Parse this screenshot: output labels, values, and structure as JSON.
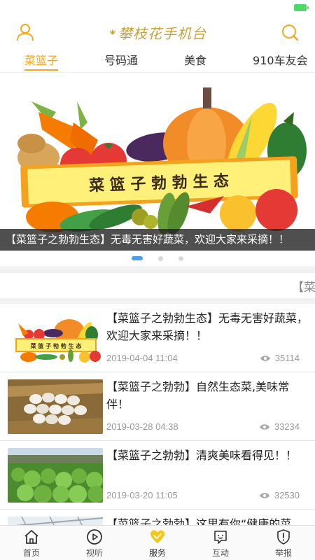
{
  "colors": {
    "accent": "#f5a623",
    "logo_gold": "#c8a13a",
    "indicator_blue": "#4a9eea",
    "battery_green": "#4cd964"
  },
  "header": {
    "logo_text": "攀枝花手机台",
    "left_icon": "user-icon",
    "right_icon": "search-icon"
  },
  "tabs": [
    {
      "label": "菜篮子",
      "active": true
    },
    {
      "label": "号码通",
      "active": false
    },
    {
      "label": "美食",
      "active": false
    },
    {
      "label": "910车友会",
      "active": false
    }
  ],
  "banner": {
    "sign_text": "菜 篮 子 勃 勃 生 态",
    "caption": "【菜篮子之勃勃生态】无毒无害好蔬菜，欢迎大家来采摘！！",
    "page_count": 3,
    "active_page": 0
  },
  "marquee": {
    "text": "【菜"
  },
  "news": [
    {
      "title": "【菜篮子之勃勃生态】无毒无害好蔬菜，欢迎大家来采摘！！",
      "date": "2019-04-04 11:04",
      "views": "35114",
      "thumb": "vegetables-banner"
    },
    {
      "title": "【菜篮子之勃勃】自然生态菜,美味常伴！",
      "date": "2019-03-28 04:38",
      "views": "33234",
      "thumb": "eggs-in-hay"
    },
    {
      "title": "【菜篮子之勃勃】清爽美味看得见！！",
      "date": "2019-03-20 11:05",
      "views": "32530",
      "thumb": "lettuce-field"
    },
    {
      "title": "【菜篮子之勃勃】这里有你“健康的菜",
      "date": "",
      "views": "",
      "thumb": "greenhouse"
    }
  ],
  "bottom_nav": [
    {
      "label": "首页",
      "icon": "home-icon",
      "active": false
    },
    {
      "label": "视听",
      "icon": "play-icon",
      "active": false
    },
    {
      "label": "服务",
      "icon": "heart-icon",
      "active": true
    },
    {
      "label": "互动",
      "icon": "chat-face-icon",
      "active": false
    },
    {
      "label": "举报",
      "icon": "shield-alert-icon",
      "active": false
    }
  ]
}
